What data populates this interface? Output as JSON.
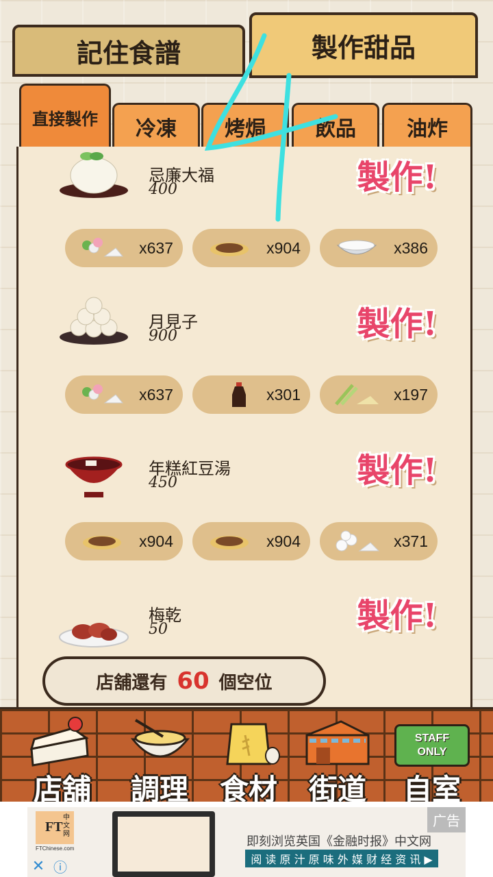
{
  "top_tabs": {
    "recipes": "記住食譜",
    "make": "製作甜品"
  },
  "sub_tabs": {
    "direct": "直接製作",
    "cold": "冷凍",
    "bake": "烤焗",
    "drink": "飲品",
    "fry": "油炸"
  },
  "make_label": "製作!",
  "recipes": [
    {
      "name": "忌廉大福",
      "price": "400",
      "ingredients": [
        {
          "icon": "dango-flour-icon",
          "count": "x637"
        },
        {
          "icon": "bean-powder-icon",
          "count": "x904"
        },
        {
          "icon": "cream-bowl-icon",
          "count": "x386"
        }
      ]
    },
    {
      "name": "月見子",
      "price": "900",
      "ingredients": [
        {
          "icon": "dango-flour-icon",
          "count": "x637"
        },
        {
          "icon": "soy-sauce-icon",
          "count": "x301"
        },
        {
          "icon": "herb-powder-icon",
          "count": "x197"
        }
      ]
    },
    {
      "name": "年糕紅豆湯",
      "price": "450",
      "ingredients": [
        {
          "icon": "bean-powder-icon",
          "count": "x904"
        },
        {
          "icon": "bean-powder-icon",
          "count": "x904"
        },
        {
          "icon": "mochi-flour-icon",
          "count": "x371"
        }
      ]
    },
    {
      "name": "梅乾",
      "price": "50"
    }
  ],
  "seats": {
    "prefix": "店舖還有",
    "count": "60",
    "suffix": "個空位"
  },
  "nav": {
    "shop": "店舖",
    "cook": "調理",
    "ingredients": "食材",
    "street": "街道",
    "room": "自室",
    "staff_sign": "STAFF ONLY"
  },
  "ad": {
    "logo": "FT",
    "logo_sub": "中文网",
    "site": "FTChinese.com",
    "headline": "即刻浏览英国《金融时报》中文网",
    "cta": "阅 读 原 汁 原 味 外 媒 财 经 资 讯 ▶",
    "tag": "广告",
    "close": "✕",
    "info": "ⓘ"
  },
  "colors": {
    "make_pink": "#e8456a",
    "seat_red": "#d8342e",
    "tab_orange": "#f4a150",
    "chip_tan": "#dfbf8c"
  }
}
